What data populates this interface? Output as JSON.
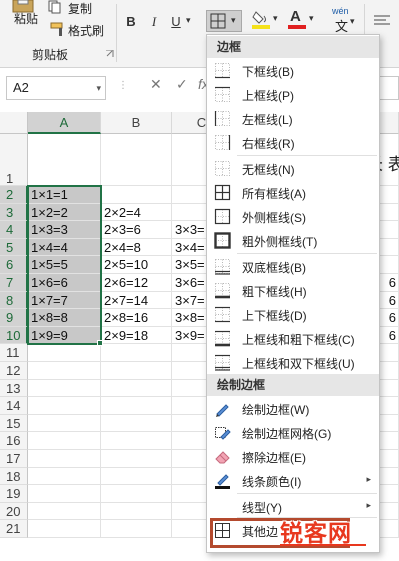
{
  "ribbon": {
    "paste_label": "粘贴",
    "copy_label": "复制",
    "format_painter_label": "格式刷",
    "clipboard_group": "剪贴板",
    "bold": "B",
    "italic": "I",
    "underline": "U",
    "wen_label": "wén",
    "wen_char": "文",
    "dropdown_arrow": "▾",
    "fill_color": "#f5e21b",
    "font_color": "#e02020",
    "accent": "#217346"
  },
  "formula_bar": {
    "name_box": "A2",
    "cancel": "✕",
    "enter": "✓",
    "fx": "fx"
  },
  "grid": {
    "columns": [
      "A",
      "B",
      "C"
    ],
    "rows": [
      "1",
      "2",
      "3",
      "4",
      "5",
      "6",
      "7",
      "8",
      "9",
      "10",
      "11",
      "12",
      "13",
      "14",
      "15",
      "16",
      "17",
      "18",
      "19",
      "20",
      "21"
    ],
    "col_a": [
      "",
      "1×1=1",
      "1×2=2",
      "1×3=3",
      "1×4=4",
      "1×5=5",
      "1×6=6",
      "1×7=7",
      "1×8=8",
      "1×9=9"
    ],
    "col_b": [
      "",
      "",
      "2×2=4",
      "2×3=6",
      "2×4=8",
      "2×5=10",
      "2×6=12",
      "2×7=14",
      "2×8=16",
      "2×9=18"
    ],
    "col_c": [
      "",
      "",
      "",
      "3×3=",
      "3×4=",
      "3×5=",
      "3×6=",
      "3×7=",
      "3×8=",
      "3×9="
    ],
    "partial_title": "长 表",
    "right_edge_values": [
      "",
      "",
      "",
      "",
      "",
      "",
      "6",
      "6",
      "6",
      "6"
    ]
  },
  "menu": {
    "section_borders": "边框",
    "section_draw": "绘制边框",
    "items": [
      {
        "label": "下框线(B)",
        "icon": "bottom-border-icon"
      },
      {
        "label": "上框线(P)",
        "icon": "top-border-icon"
      },
      {
        "label": "左框线(L)",
        "icon": "left-border-icon"
      },
      {
        "label": "右框线(R)",
        "icon": "right-border-icon"
      },
      {
        "label": "无框线(N)",
        "icon": "no-border-icon"
      },
      {
        "label": "所有框线(A)",
        "icon": "all-borders-icon"
      },
      {
        "label": "外侧框线(S)",
        "icon": "outside-borders-icon"
      },
      {
        "label": "粗外侧框线(T)",
        "icon": "thick-outside-borders-icon"
      },
      {
        "label": "双底框线(B)",
        "icon": "double-bottom-border-icon"
      },
      {
        "label": "粗下框线(H)",
        "icon": "thick-bottom-border-icon"
      },
      {
        "label": "上下框线(D)",
        "icon": "top-bottom-border-icon"
      },
      {
        "label": "上框线和粗下框线(C)",
        "icon": "top-thick-bottom-border-icon"
      },
      {
        "label": "上框线和双下框线(U)",
        "icon": "top-double-bottom-border-icon"
      }
    ],
    "draw_items": [
      {
        "label": "绘制边框(W)",
        "icon": "draw-border-icon"
      },
      {
        "label": "绘制边框网格(G)",
        "icon": "draw-border-grid-icon"
      },
      {
        "label": "擦除边框(E)",
        "icon": "erase-border-icon"
      },
      {
        "label": "线条颜色(I)",
        "icon": "line-color-icon",
        "submenu": "▸"
      },
      {
        "label": "线型(Y)",
        "icon": "line-style-icon",
        "submenu": "▸"
      },
      {
        "label": "其他边",
        "icon": "more-borders-icon"
      }
    ],
    "highlight_color": "#b44a2e"
  },
  "watermark": {
    "text": "锐客网",
    "color": "#e8381e"
  }
}
